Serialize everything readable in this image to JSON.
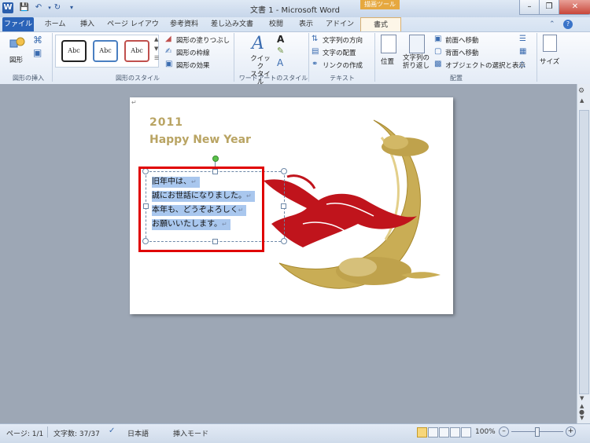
{
  "window": {
    "title": "文書 1 - Microsoft Word",
    "app_icon": "W",
    "controls": [
      "minimize-icon",
      "restore-icon",
      "close-icon"
    ]
  },
  "context_tab_header": "描画ツール",
  "tabs": [
    "ファイル",
    "ホーム",
    "挿入",
    "ページ レイアウト",
    "参考資料",
    "差し込み文書",
    "校閲",
    "表示",
    "アドイン",
    "書式"
  ],
  "ribbon": {
    "insert_shape_group": {
      "label": "図形の挿入",
      "shapes_button": "図形"
    },
    "shape_styles_group": {
      "label": "図形のスタイル",
      "gallery": [
        "Abc",
        "Abc",
        "Abc"
      ],
      "fill": "図形の塗りつぶし",
      "outline": "図形の枠線",
      "effects": "図形の効果"
    },
    "wordart_group": {
      "label": "ワードアートのスタイル",
      "quick_style": "クイック\nスタイル"
    },
    "text_group": {
      "label": "テキスト",
      "direction": "文字列の方向",
      "alignment": "文字の配置",
      "link": "リンクの作成"
    },
    "arrange_group": {
      "label": "配置",
      "position": "位置",
      "wrap": "文字列の\n折り返し",
      "bring_forward": "前面へ移動",
      "send_backward": "背面へ移動",
      "selection_pane": "オブジェクトの選択と表示"
    },
    "size_group": {
      "size": "サイズ"
    }
  },
  "document": {
    "year": "2011",
    "greeting": "Happy New Year",
    "textbox_lines": [
      "旧年中は、",
      "誠にお世話になりました。",
      "本年も、どうぞよろしく",
      "お願いいたします。"
    ]
  },
  "statusbar": {
    "page": "ページ: 1/1",
    "word_count": "文字数: 37/37",
    "language": "日本語",
    "mode": "挿入モード",
    "zoom": "100%"
  },
  "colors": {
    "file_tab": "#2a63b8",
    "highlight_box": "#e00000",
    "card_gold": "#b9a463",
    "card_red": "#c0141c",
    "selection": "#a9c7ee"
  }
}
